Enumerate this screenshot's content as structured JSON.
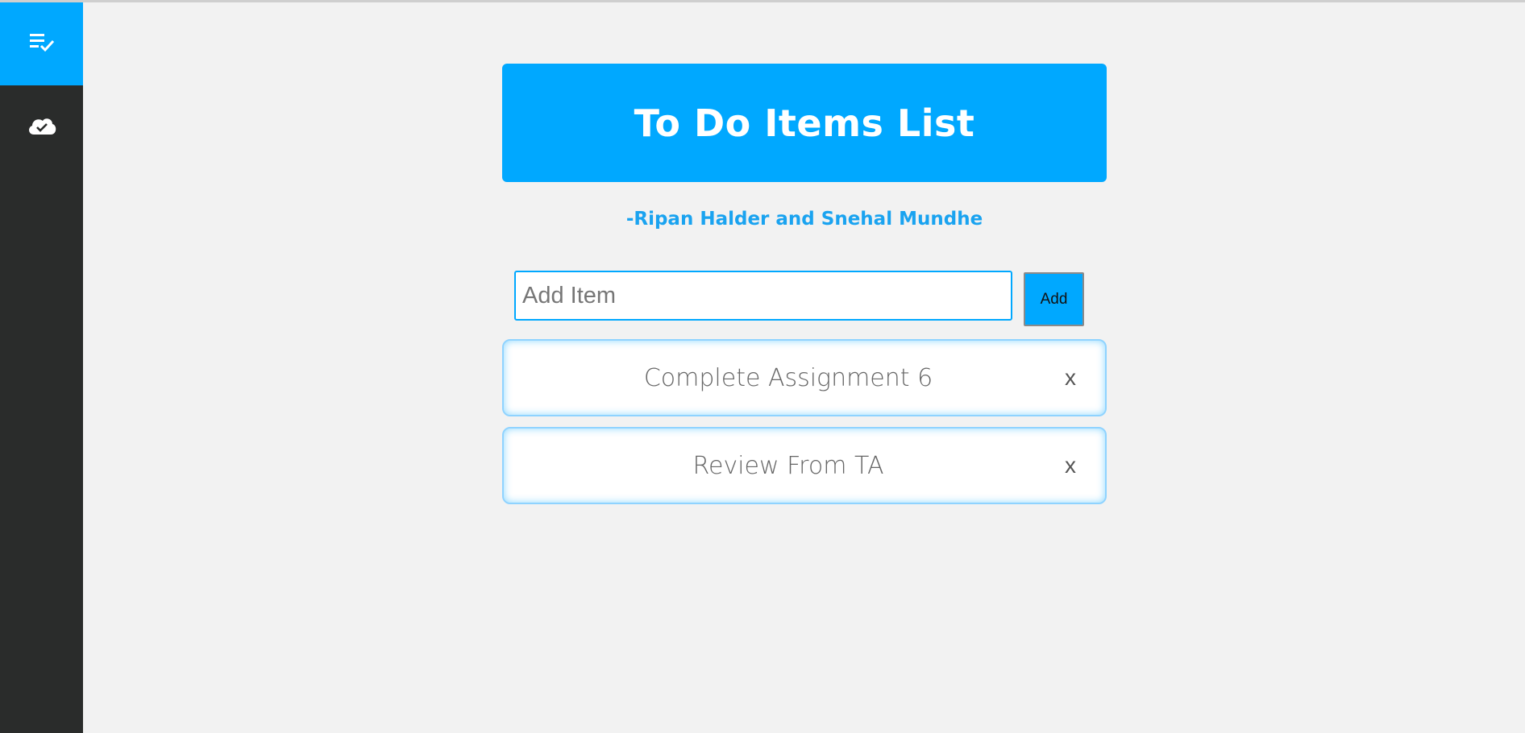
{
  "sidebar": {
    "items": [
      {
        "icon": "playlist-check-icon",
        "active": true
      },
      {
        "icon": "cloud-check-icon",
        "active": false
      }
    ]
  },
  "banner": {
    "title": "To Do Items List"
  },
  "authors": "-Ripan Halder and Snehal Mundhe",
  "add_form": {
    "placeholder": "Add Item",
    "value": "",
    "button_label": "Add"
  },
  "todos": [
    {
      "text": "Complete Assignment 6",
      "delete_label": "x"
    },
    {
      "text": "Review From TA",
      "delete_label": "x"
    }
  ],
  "colors": {
    "accent": "#00a8ff",
    "sidebar": "#2a2c2b",
    "background": "#f2f2f2"
  }
}
